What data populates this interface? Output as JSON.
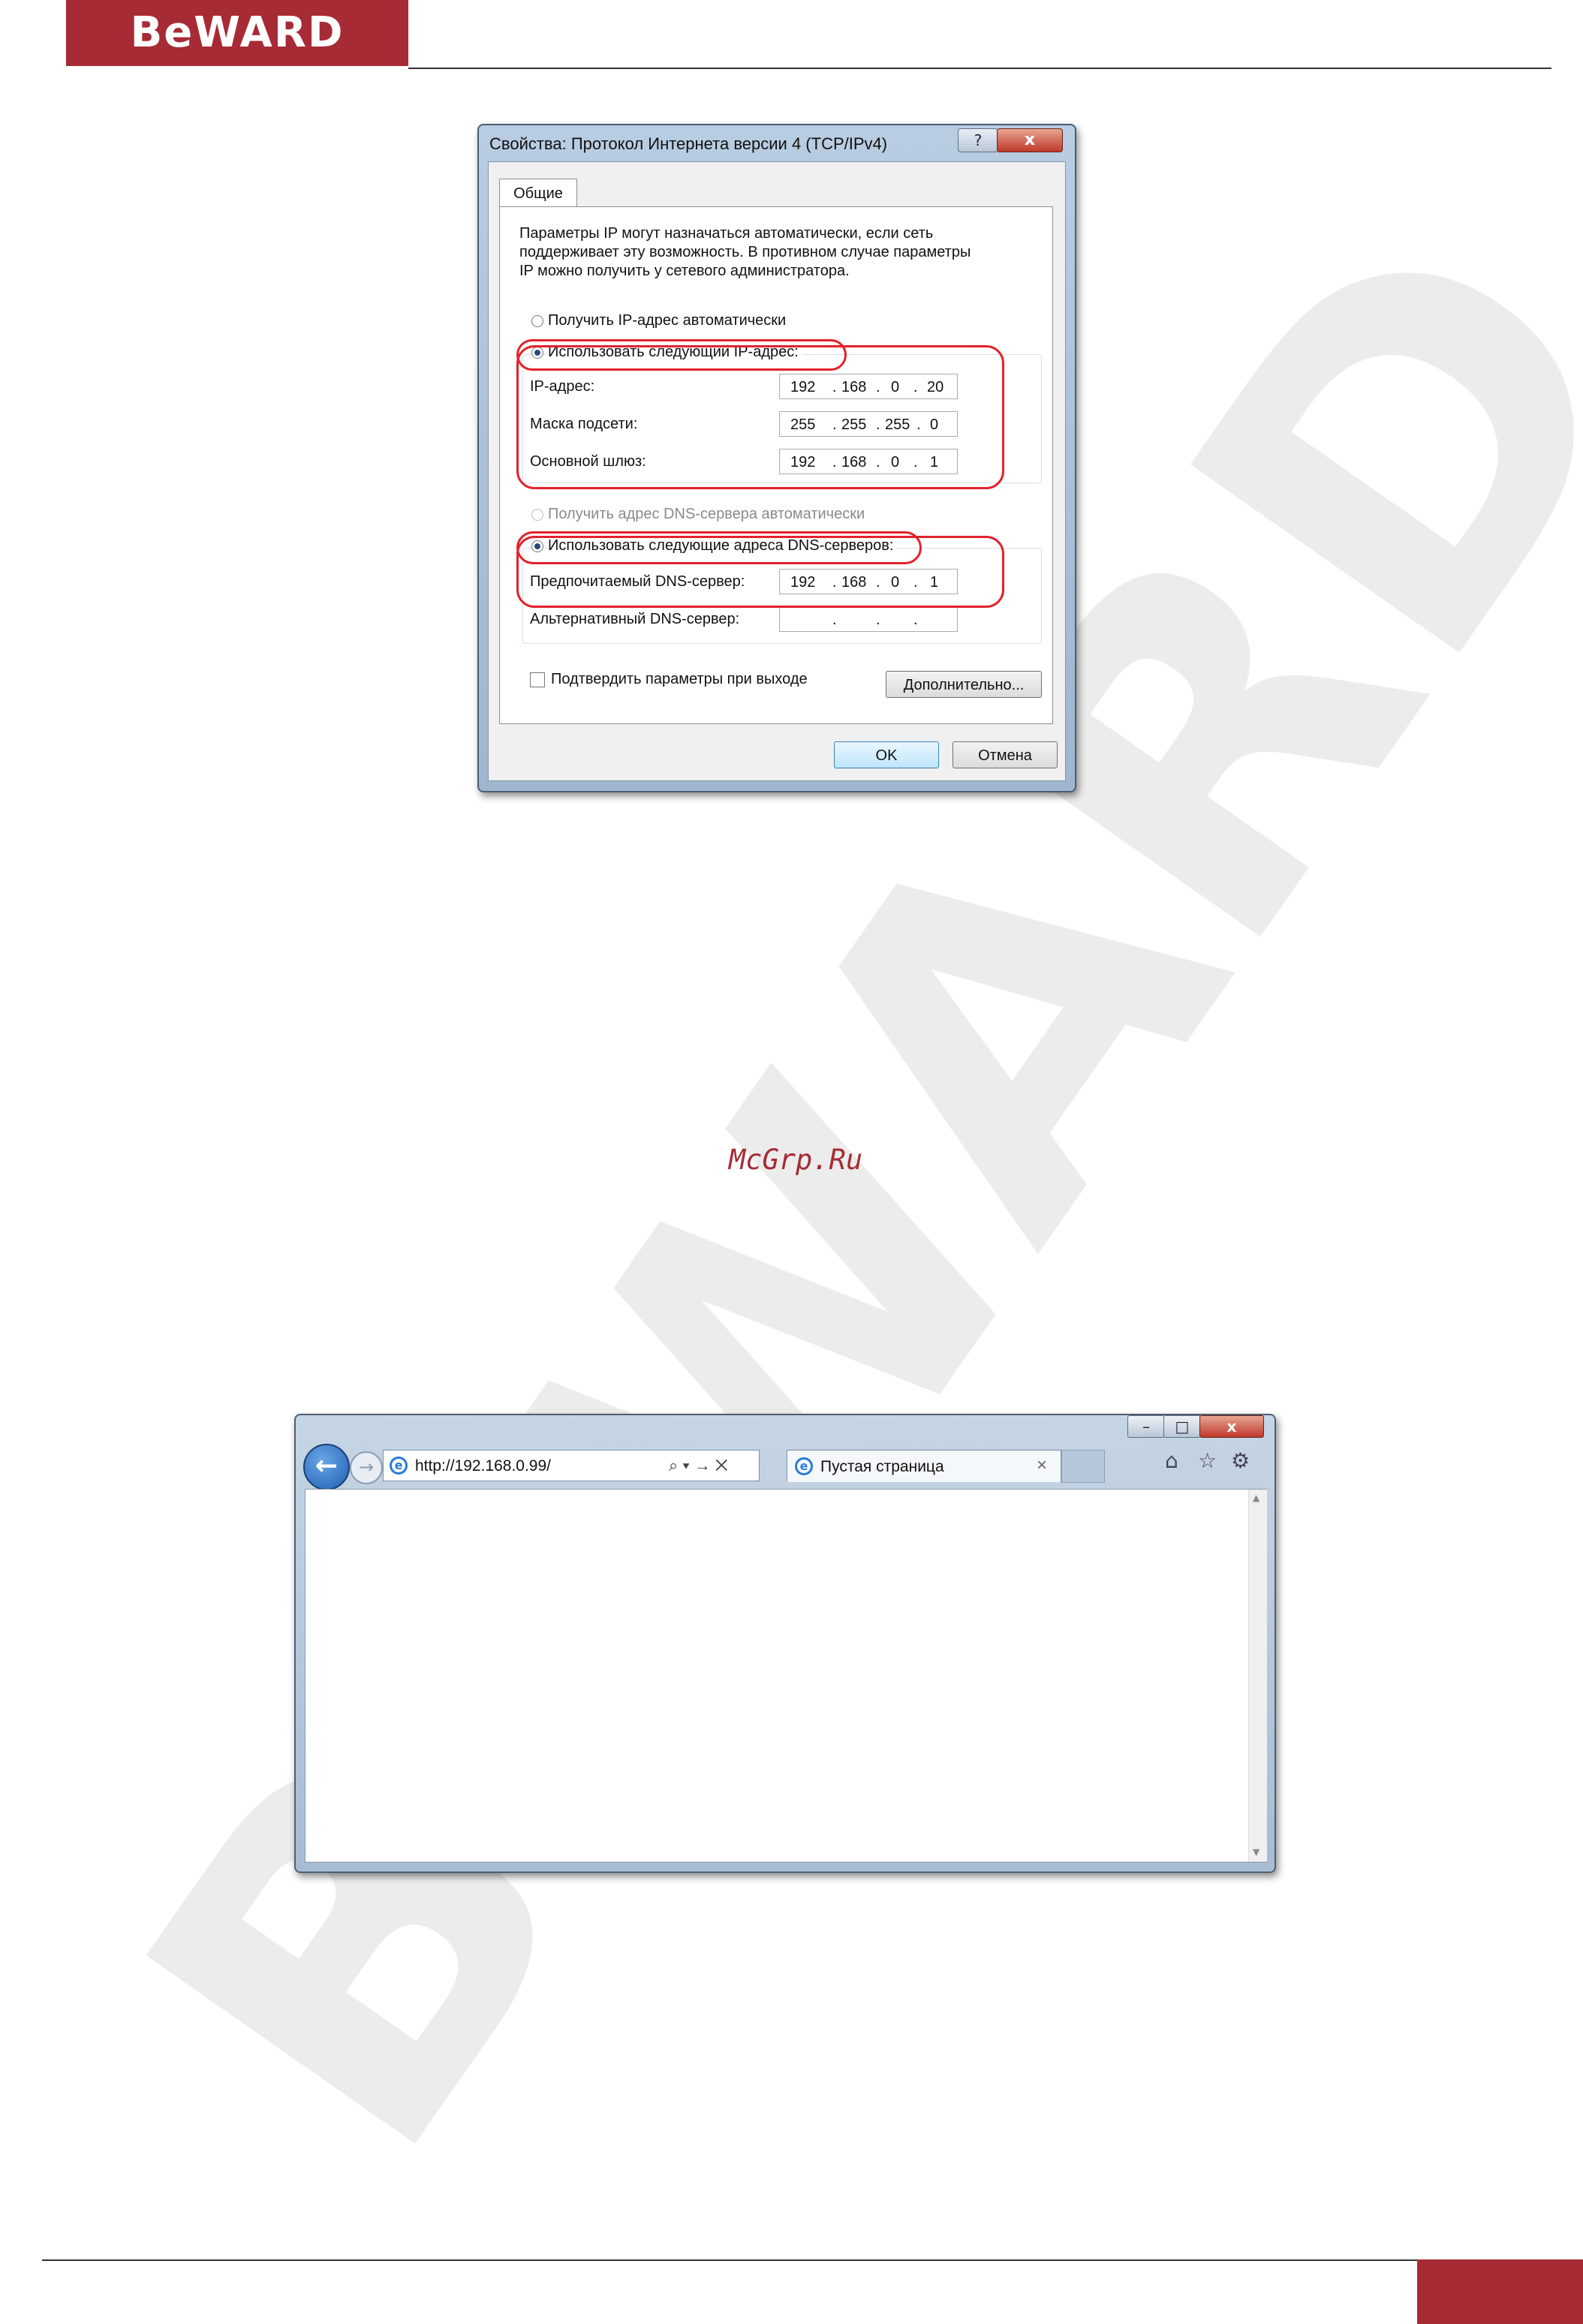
{
  "header": {
    "logo_text": "BeWARD",
    "brand_color": "#a72b35"
  },
  "watermark_text": "BeWARD",
  "center_link": "McGrp.Ru",
  "dialog": {
    "title": "Свойства: Протокол Интернета версии 4 (TCP/IPv4)",
    "help_label": "?",
    "close_label": "x",
    "tab_general": "Общие",
    "intro_line1": "Параметры IP могут назначаться автоматически, если сеть",
    "intro_line2": "поддерживает эту возможность. В противном случае параметры",
    "intro_line3": "IP можно получить у сетевого администратора.",
    "radio_ip_auto": "Получить IP-адрес автоматически",
    "radio_ip_manual": "Использовать следующий IP-адрес:",
    "ip_label": "IP-адрес:",
    "ip_value": [
      "192",
      "168",
      "0",
      "20"
    ],
    "mask_label": "Маска подсети:",
    "mask_value": [
      "255",
      "255",
      "255",
      "0"
    ],
    "gateway_label": "Основной шлюз:",
    "gateway_value": [
      "192",
      "168",
      "0",
      "1"
    ],
    "radio_dns_auto": "Получить адрес DNS-сервера автоматически",
    "radio_dns_manual": "Использовать следующие адреса DNS-серверов:",
    "dns_pref_label": "Предпочитаемый DNS-сервер:",
    "dns_pref_value": [
      "192",
      "168",
      "0",
      "1"
    ],
    "dns_alt_label": "Альтернативный DNS-сервер:",
    "dot": ".",
    "validate_label": "Подтвердить параметры при выходе",
    "advanced_button": "Дополнительно...",
    "ok_button": "OK",
    "cancel_button": "Отмена"
  },
  "browser": {
    "minimize_label": "–",
    "maximize_label": "□",
    "close_label": "x",
    "back_glyph": "←",
    "forward_glyph": "→",
    "address": "http://192.168.0.99/",
    "address_tools": "⌕ ▾ → ✕",
    "tab_title": "Пустая страница",
    "tab_close": "×",
    "home_glyph": "⌂",
    "favorites_glyph": "☆",
    "settings_glyph": "⚙",
    "scroll_up": "▲",
    "scroll_down": "▼"
  }
}
